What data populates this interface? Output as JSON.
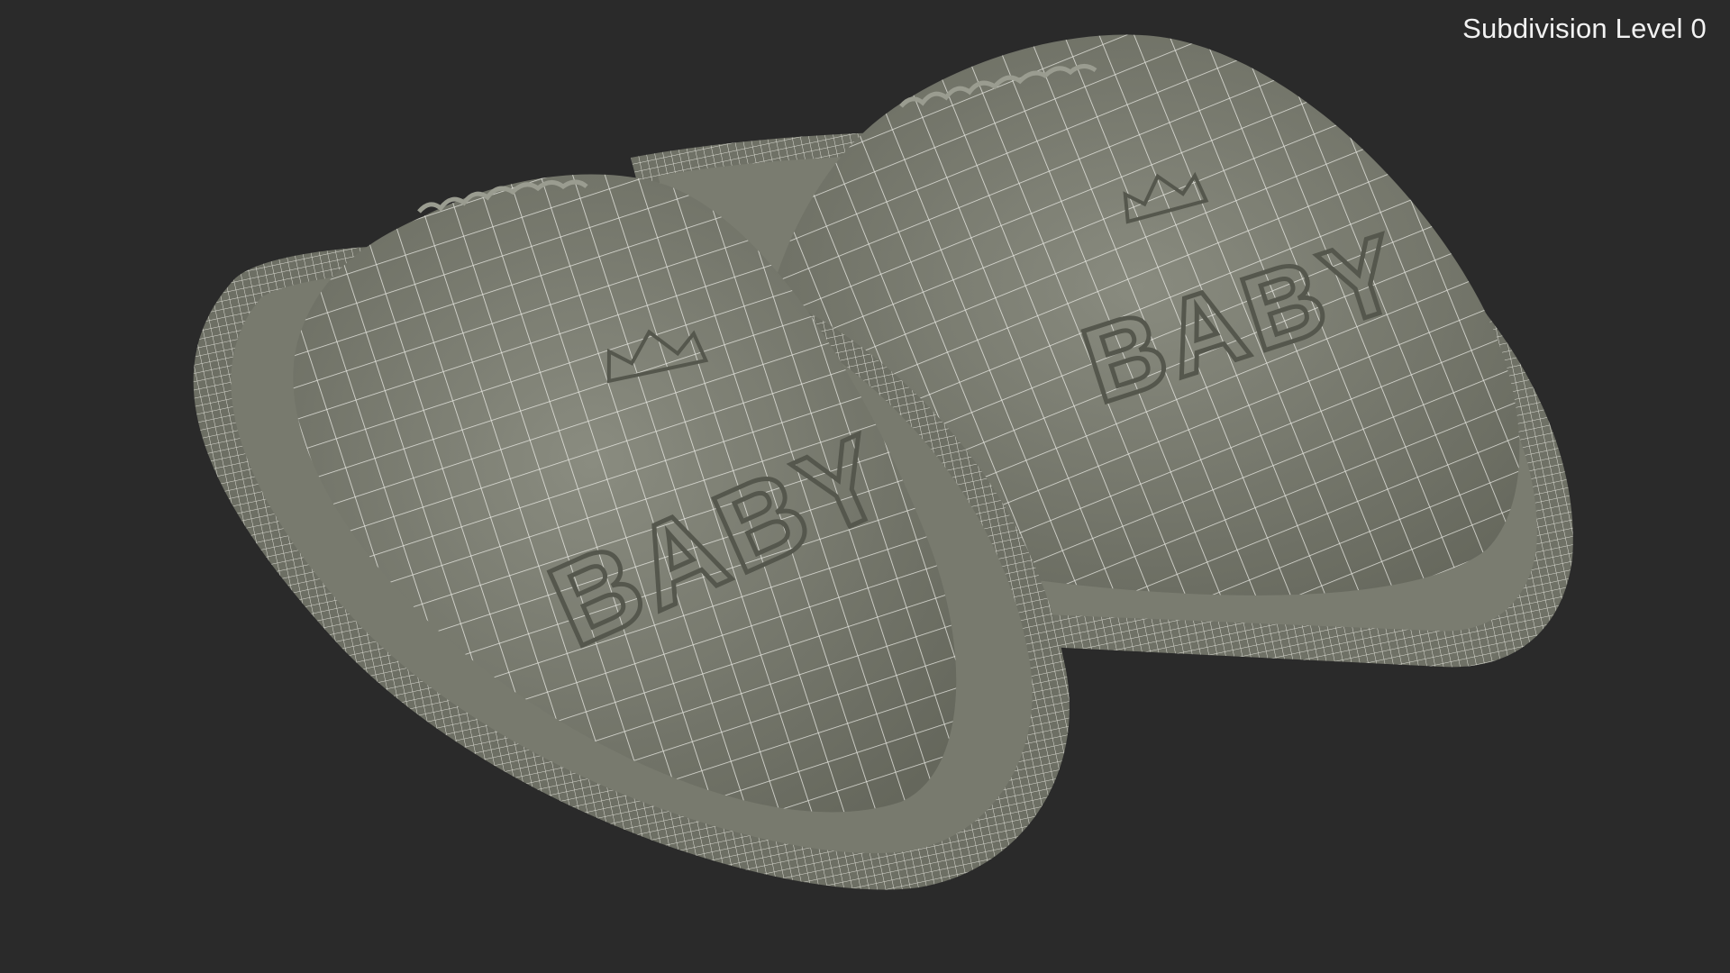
{
  "viewport": {
    "background": "#2a2a2a",
    "overlay_label": "Subdivision Level 0"
  },
  "model": {
    "surface_color": "#7f8175",
    "wire_color": "#ffffff",
    "slippers": [
      {
        "side": "left",
        "embossed_text": "BABY",
        "emblem": "crown-icon"
      },
      {
        "side": "right",
        "embossed_text": "BABY",
        "emblem": "crown-icon"
      }
    ]
  }
}
